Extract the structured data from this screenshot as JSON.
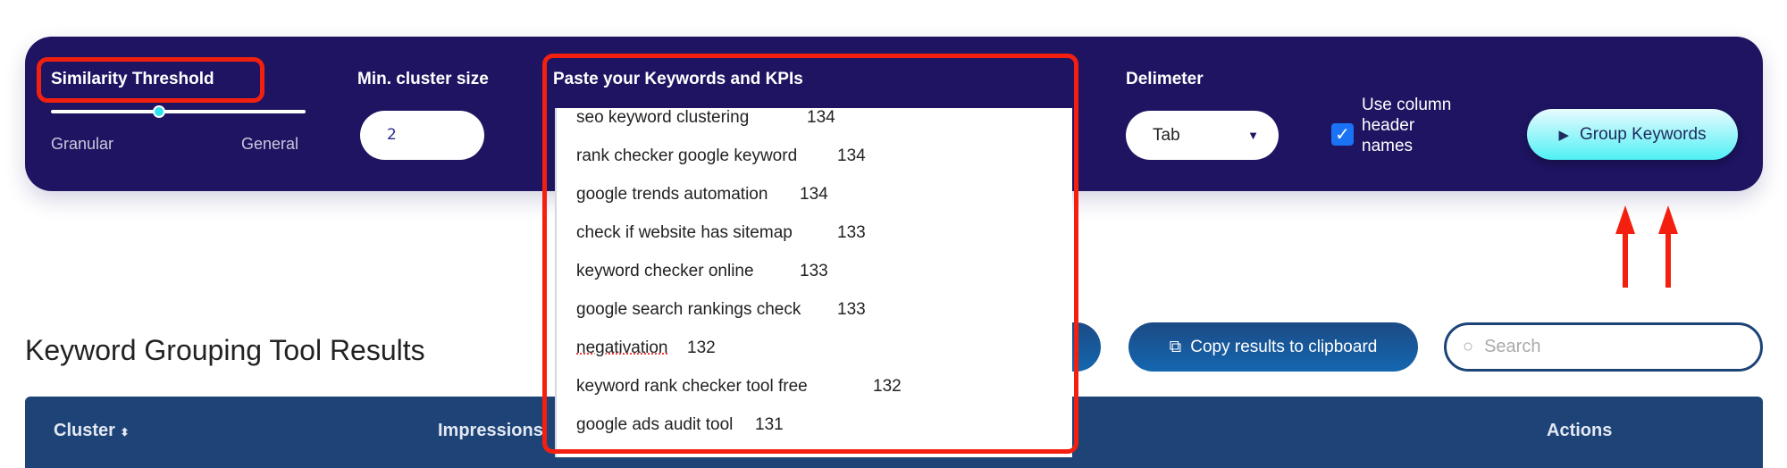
{
  "controls": {
    "similarity_label": "Similarity Threshold",
    "similarity_value": 0.43,
    "granular_label": "Granular",
    "general_label": "General",
    "min_cluster_label": "Min. cluster size",
    "min_cluster_value": "2",
    "paste_label": "Paste your Keywords and KPIs",
    "keywords": [
      {
        "kw": "seo keyword clustering",
        "kpi": "134"
      },
      {
        "kw": "rank checker google keyword",
        "kpi": "134"
      },
      {
        "kw": "google trends automation",
        "kpi": "134"
      },
      {
        "kw": "check if website has sitemap",
        "kpi": "133"
      },
      {
        "kw": "keyword checker online",
        "kpi": "133"
      },
      {
        "kw": "google search rankings check",
        "kpi": "133"
      },
      {
        "kw": "negativation",
        "kpi": "132"
      },
      {
        "kw": "keyword rank checker tool free",
        "kpi": "132"
      },
      {
        "kw": "google ads audit tool",
        "kpi": "131"
      }
    ],
    "delimiter_label": "Delimeter",
    "delimiter_value": "Tab",
    "use_header_label": "Use column header names",
    "use_header_checked": true,
    "group_button": "Group Keywords"
  },
  "results": {
    "title": "Keyword Grouping Tool Results",
    "copy_button": "Copy results to clipboard",
    "search_placeholder": "Search",
    "columns": [
      "Cluster",
      "Impressions",
      "Actions"
    ]
  },
  "colors": {
    "panel": "#1e1462",
    "accent": "#2fe4f0",
    "annotation": "#f4200f",
    "table_header": "#1d4377"
  }
}
